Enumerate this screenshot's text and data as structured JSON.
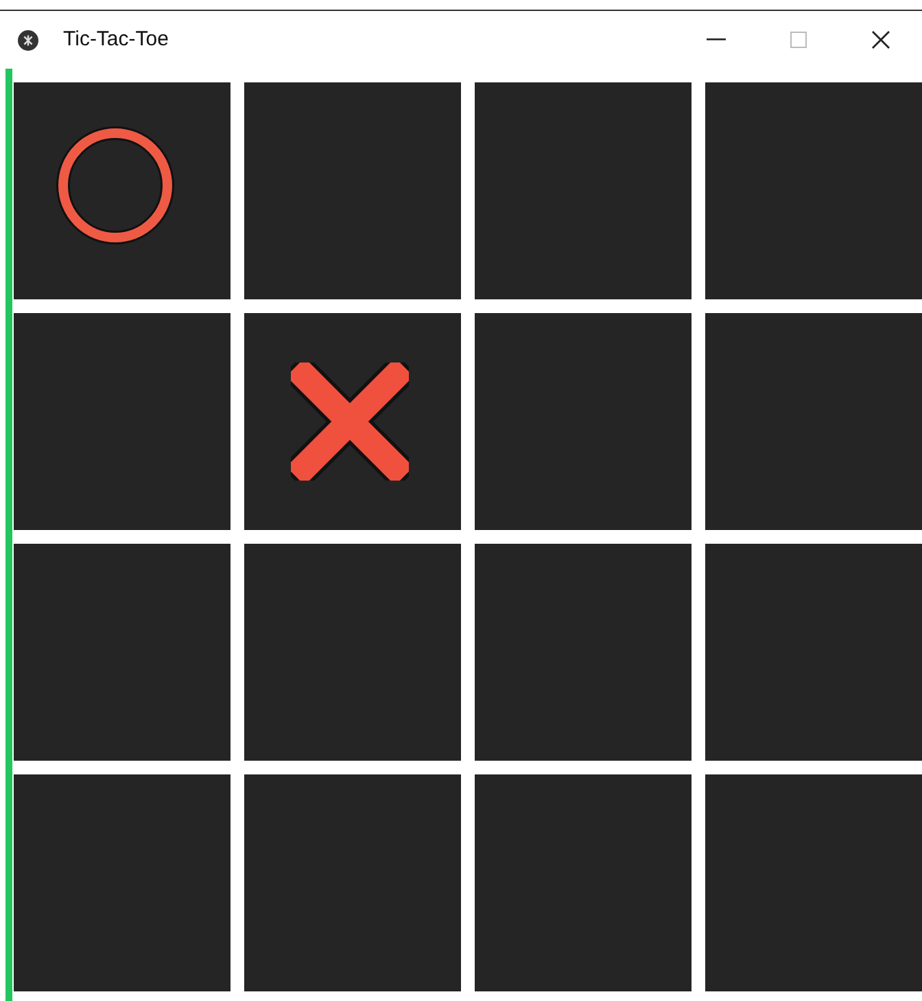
{
  "window": {
    "title": "Tic-Tac-Toe"
  },
  "board": [
    [
      {
        "kind": "o"
      },
      {
        "kind": "empty"
      },
      {
        "kind": "empty"
      },
      {
        "kind": "empty"
      }
    ],
    [
      {
        "kind": "empty"
      },
      {
        "kind": "x"
      },
      {
        "kind": "empty"
      },
      {
        "kind": "empty"
      }
    ],
    [
      {
        "kind": "empty"
      },
      {
        "kind": "empty"
      },
      {
        "kind": "empty"
      },
      {
        "kind": "empty"
      }
    ],
    [
      {
        "kind": "empty"
      },
      {
        "kind": "empty"
      },
      {
        "kind": "empty"
      },
      {
        "kind": "empty"
      }
    ]
  ]
}
